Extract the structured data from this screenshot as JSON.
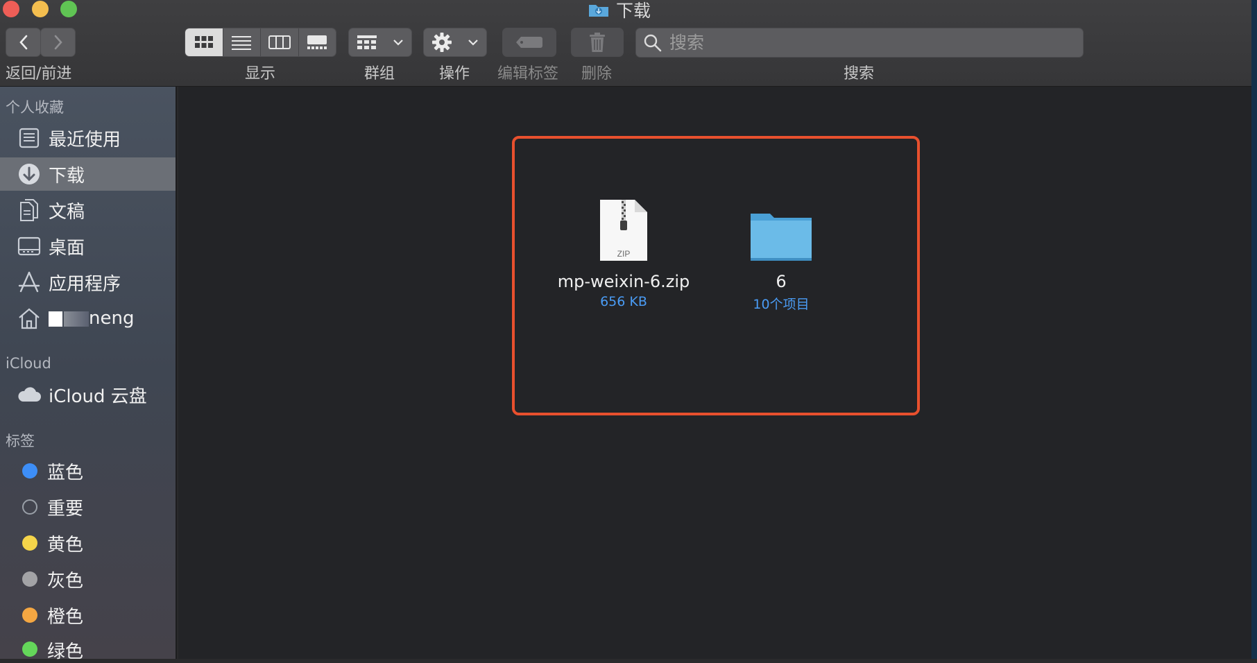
{
  "window": {
    "title": "下载"
  },
  "toolbar": {
    "back_forward_label": "返回/前进",
    "view_label": "显示",
    "group_label": "群组",
    "action_label": "操作",
    "edit_tags_label": "编辑标签",
    "delete_label": "删除",
    "search_label": "搜索",
    "search_placeholder": "搜索"
  },
  "sidebar": {
    "favorites_header": "个人收藏",
    "favorites": [
      {
        "label": "最近使用",
        "icon": "recents-icon"
      },
      {
        "label": "下载",
        "icon": "downloads-icon",
        "selected": true
      },
      {
        "label": "文稿",
        "icon": "documents-icon"
      },
      {
        "label": "桌面",
        "icon": "desktop-icon"
      },
      {
        "label": "应用程序",
        "icon": "applications-icon"
      },
      {
        "label": "neng",
        "icon": "home-icon"
      }
    ],
    "icloud_header": "iCloud",
    "icloud": [
      {
        "label": "iCloud 云盘",
        "icon": "cloud-icon"
      }
    ],
    "tags_header": "标签",
    "tags": [
      {
        "label": "蓝色",
        "color": "#3d8ef7"
      },
      {
        "label": "重要",
        "color": "transparent"
      },
      {
        "label": "黄色",
        "color": "#f5d54a"
      },
      {
        "label": "灰色",
        "color": "#a3a3a6"
      },
      {
        "label": "橙色",
        "color": "#f5a742"
      },
      {
        "label": "绿色",
        "color": "#64d65a"
      }
    ]
  },
  "files": [
    {
      "name": "mp-weixin-6.zip",
      "sub": "656 KB",
      "icon": "zip-file-icon",
      "badge": "ZIP"
    },
    {
      "name": "6",
      "sub": "10个项目",
      "icon": "folder-icon"
    }
  ],
  "colors": {
    "highlight": "#e8502e",
    "accent": "#4a9cf5"
  }
}
